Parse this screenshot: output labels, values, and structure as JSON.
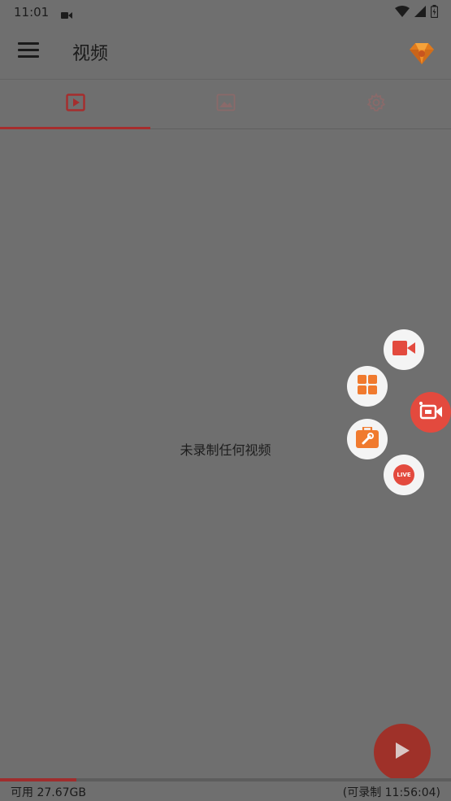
{
  "status_bar": {
    "time": "11:01",
    "icons": [
      "video-camera-icon",
      "wifi-icon",
      "signal-icon",
      "battery-icon"
    ]
  },
  "app_bar": {
    "title": "视频",
    "menu_icon": "hamburger-menu-icon",
    "premium_icon": "diamond-icon"
  },
  "tabs": [
    {
      "icon": "video-play-icon",
      "selected": true
    },
    {
      "icon": "image-icon",
      "selected": false
    },
    {
      "icon": "gear-icon",
      "selected": false
    }
  ],
  "main": {
    "empty_message": "未录制任何视频"
  },
  "floating_menu": {
    "items": [
      "video-camera-icon",
      "tools-grid-icon",
      "toolbox-icon",
      "live-icon"
    ],
    "live_label": "LIVE",
    "main_icon": "record-camera-icon"
  },
  "footer": {
    "available": "可用 27.67GB",
    "recordable": "(可录制 11:56:04)",
    "storage_used_fraction": 0.17
  },
  "colors": {
    "accent": "#e34a3e",
    "overlay": "#6f6f6f",
    "indicator": "#a62d2d",
    "diamond": "#f08a1c"
  }
}
